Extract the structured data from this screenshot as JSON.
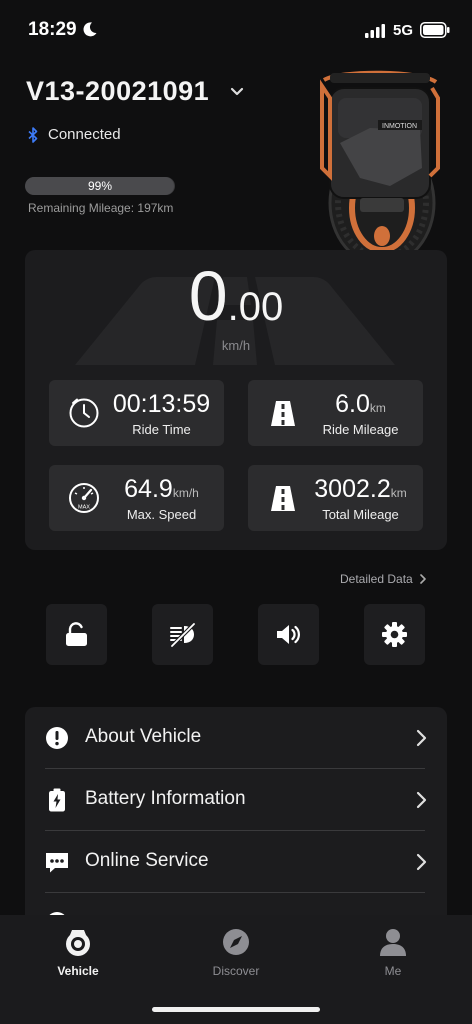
{
  "status_bar": {
    "time": "18:29",
    "network": "5G"
  },
  "header": {
    "device_name": "V13-20021091",
    "connection_status": "Connected",
    "battery_percent_label": "99%",
    "battery_fraction": 0.99,
    "remaining_mileage": "Remaining Mileage: 197km"
  },
  "speed": {
    "integer": "0",
    "decimals": ".00",
    "unit": "km/h"
  },
  "stats": [
    {
      "value": "00:13:59",
      "unit": "",
      "label": "Ride Time",
      "icon": "clock-icon"
    },
    {
      "value": "6.0",
      "unit": "km",
      "label": "Ride Mileage",
      "icon": "road-icon"
    },
    {
      "value": "64.9",
      "unit": "km/h",
      "label": "Max. Speed",
      "icon": "speedometer-max-icon"
    },
    {
      "value": "3002.2",
      "unit": "km",
      "label": "Total Mileage",
      "icon": "road-icon"
    }
  ],
  "detailed_data_label": "Detailed Data",
  "quick_actions": [
    {
      "name": "unlock",
      "icon": "unlock-icon"
    },
    {
      "name": "headlight",
      "icon": "headlight-off-icon"
    },
    {
      "name": "sound",
      "icon": "speaker-icon"
    },
    {
      "name": "settings",
      "icon": "gear-icon"
    }
  ],
  "menu": [
    {
      "label": "About Vehicle",
      "icon": "info-alert-icon"
    },
    {
      "label": "Battery Information",
      "icon": "battery-icon"
    },
    {
      "label": "Online Service",
      "icon": "chat-icon"
    }
  ],
  "tabs": [
    {
      "label": "Vehicle",
      "icon": "wheel-icon",
      "active": true
    },
    {
      "label": "Discover",
      "icon": "compass-icon",
      "active": false
    },
    {
      "label": "Me",
      "icon": "person-icon",
      "active": false
    }
  ],
  "colors": {
    "accent_blue": "#3d7bf7",
    "wheel_orange": "#d0703a",
    "panel_bg": "#1c1c1e",
    "card_bg": "#2c2c2e"
  }
}
